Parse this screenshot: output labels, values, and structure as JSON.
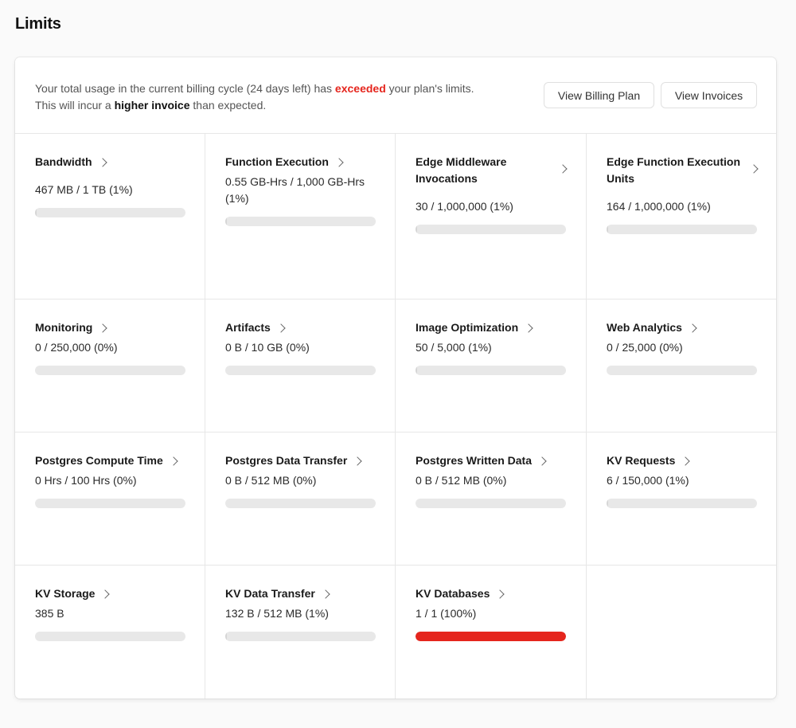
{
  "page": {
    "title": "Limits"
  },
  "banner": {
    "text_part1": "Your total usage in the current billing cycle (24 days left) has ",
    "exceeded": "exceeded",
    "text_part2": " your plan's limits.",
    "text_part3": "This will incur a ",
    "higher_invoice": "higher invoice",
    "text_part4": " than expected.",
    "view_billing_plan": "View Billing Plan",
    "view_invoices": "View Invoices"
  },
  "colors": {
    "exceeded": "#e5251d",
    "bar_track": "#e8e8e8",
    "bar_fill_normal": "#d6d6d6",
    "bar_fill_over": "#e5251d"
  },
  "limits": [
    {
      "name": "Bandwidth",
      "usage": "467 MB / 1 TB (1%)",
      "progress": 0.01
    },
    {
      "name": "Function Execution",
      "usage": "0.55 GB-Hrs / 1,000 GB-Hrs (1%)",
      "progress": 0.01
    },
    {
      "name": "Edge Middleware Invocations",
      "usage": "30 / 1,000,000 (1%)",
      "progress": 0.01
    },
    {
      "name": "Edge Function Execution Units",
      "usage": "164 / 1,000,000 (1%)",
      "progress": 0.01
    },
    {
      "name": "Monitoring",
      "usage": "0 / 250,000 (0%)",
      "progress": 0
    },
    {
      "name": "Artifacts",
      "usage": "0 B / 10 GB (0%)",
      "progress": 0
    },
    {
      "name": "Image Optimization",
      "usage": "50 / 5,000 (1%)",
      "progress": 0.01
    },
    {
      "name": "Web Analytics",
      "usage": "0 / 25,000 (0%)",
      "progress": 0
    },
    {
      "name": "Postgres Compute Time",
      "usage": "0 Hrs / 100 Hrs (0%)",
      "progress": 0
    },
    {
      "name": "Postgres Data Transfer",
      "usage": "0 B / 512 MB (0%)",
      "progress": 0
    },
    {
      "name": "Postgres Written Data",
      "usage": "0 B / 512 MB (0%)",
      "progress": 0
    },
    {
      "name": "KV Requests",
      "usage": "6 / 150,000 (1%)",
      "progress": 0.01
    },
    {
      "name": "KV Storage",
      "usage": "385 B",
      "progress": 0
    },
    {
      "name": "KV Data Transfer",
      "usage": "132 B / 512 MB (1%)",
      "progress": 0.01
    },
    {
      "name": "KV Databases",
      "usage": "1 / 1 (100%)",
      "progress": 1.0
    }
  ]
}
